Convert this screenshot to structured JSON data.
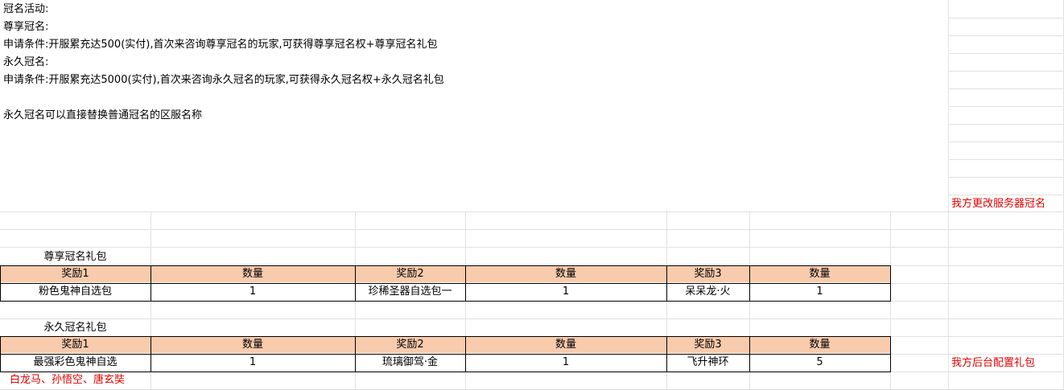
{
  "intro": {
    "line1": "冠名活动:",
    "line2": "尊享冠名:",
    "line3": "申请条件:开服累充达500(实付),首次来咨询尊享冠名的玩家,可获得尊享冠名权+尊享冠名礼包",
    "line4": "永久冠名:",
    "line5": "申请条件:开服累充达5000(实付),首次来咨询永久冠名的玩家,可获得永久冠名权+永久冠名礼包",
    "line6": "永久冠名可以直接替换普通冠名的区服名称"
  },
  "note_server": "我方更改服务器冠名",
  "note_backend": "我方后台配置礼包",
  "note_heroes": "白龙马、孙悟空、唐玄奘",
  "headers": {
    "reward1": "奖励1",
    "qty": "数量",
    "reward2": "奖励2",
    "reward3": "奖励3"
  },
  "table1": {
    "title": "尊享冠名礼包",
    "reward1": "粉色鬼神自选包",
    "qty1": "1",
    "reward2": "珍稀圣器自选包一",
    "qty2": "1",
    "reward3": "呆呆龙·火",
    "qty3": "1"
  },
  "table2": {
    "title": "永久冠名礼包",
    "reward1": "最强彩色鬼神自选",
    "qty1": "1",
    "reward2": "琉璃御驾·金",
    "qty2": "1",
    "reward3": "飞升神环",
    "qty3": "5"
  },
  "colors": {
    "header_fill": "#f8cbad",
    "note_red": "#e00000",
    "gridline": "#e1e1e1"
  }
}
